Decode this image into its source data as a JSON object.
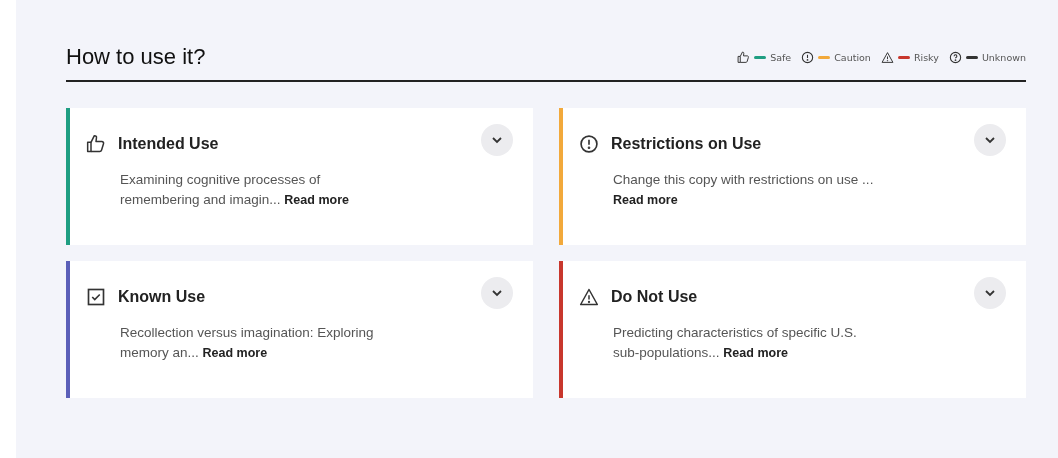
{
  "title": "How to use it?",
  "legend": [
    {
      "kind": "thumbs-up",
      "color": "#1f9e82",
      "label": "Safe"
    },
    {
      "kind": "info",
      "color": "#f2a93b",
      "label": "Caution"
    },
    {
      "kind": "warning",
      "color": "#c8372d",
      "label": "Risky"
    },
    {
      "kind": "question",
      "color": "#333333",
      "label": "Unknown"
    }
  ],
  "cards": [
    {
      "kind": "thumbs-up",
      "color": "#1f9e82",
      "title": "Intended Use",
      "description": "Examining cognitive processes of remembering and imagin...",
      "link": "Read more",
      "expanded": false
    },
    {
      "kind": "info",
      "color": "#f2a93b",
      "title": "Restrictions on Use",
      "description": "Change this copy with restrictions on use ...",
      "link": "Read more",
      "expanded": false
    },
    {
      "kind": "checkbox",
      "color": "#5b5fb8",
      "title": "Known Use",
      "description": "Recollection versus imagination: Exploring memory an...",
      "link": "Read more",
      "expanded": false
    },
    {
      "kind": "warning",
      "color": "#c8372d",
      "title": "Do Not Use",
      "description": "Predicting characteristics of specific U.S. sub-populations...",
      "link": "Read more",
      "expanded": false
    }
  ]
}
